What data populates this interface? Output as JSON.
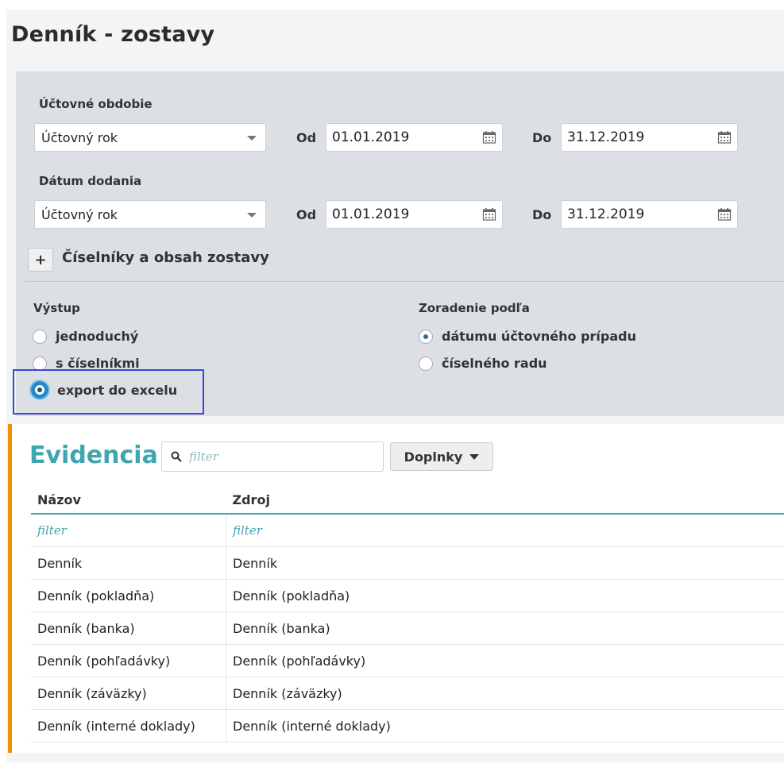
{
  "page": {
    "title": "Denník - zostavy"
  },
  "filters": {
    "accounting_period": {
      "label": "Účtovné obdobie",
      "select_value": "Účtovný rok",
      "from_label": "Od",
      "from_value": "01.01.2019",
      "to_label": "Do",
      "to_value": "31.12.2019"
    },
    "delivery_date": {
      "label": "Dátum dodania",
      "select_value": "Účtovný rok",
      "from_label": "Od",
      "from_value": "01.01.2019",
      "to_label": "Do",
      "to_value": "31.12.2019"
    },
    "expander": {
      "icon": "plus-icon",
      "symbol": "+",
      "label": "Číselníky a obsah zostavy"
    }
  },
  "output": {
    "label": "Výstup",
    "options": [
      {
        "label": "jednoduchý",
        "selected": false
      },
      {
        "label": "s číselníkmi",
        "selected": false
      },
      {
        "label": "export do excelu",
        "selected": true
      }
    ]
  },
  "sort": {
    "label": "Zoradenie podľa",
    "options": [
      {
        "label": "dátumu účtovného prípadu",
        "selected": true
      },
      {
        "label": "číselného radu",
        "selected": false
      }
    ]
  },
  "evidencia": {
    "title": "Evidencia",
    "search_placeholder": "filter",
    "addons_button": "Doplnky",
    "columns": [
      "Názov",
      "Zdroj"
    ],
    "filter_row": [
      "filter",
      "filter"
    ],
    "rows": [
      [
        "Denník",
        "Denník"
      ],
      [
        "Denník (pokladňa)",
        "Denník (pokladňa)"
      ],
      [
        "Denník (banka)",
        "Denník (banka)"
      ],
      [
        "Denník (pohľadávky)",
        "Denník (pohľadávky)"
      ],
      [
        "Denník (záväzky)",
        "Denník (záväzky)"
      ],
      [
        "Denník (interné doklady)",
        "Denník (interné doklady)"
      ]
    ]
  },
  "colors": {
    "accent": "#3ea6b1",
    "highlight_border": "#3b48d6",
    "evidencia_bar": "#f39200",
    "panel": "#dcdfe4"
  }
}
